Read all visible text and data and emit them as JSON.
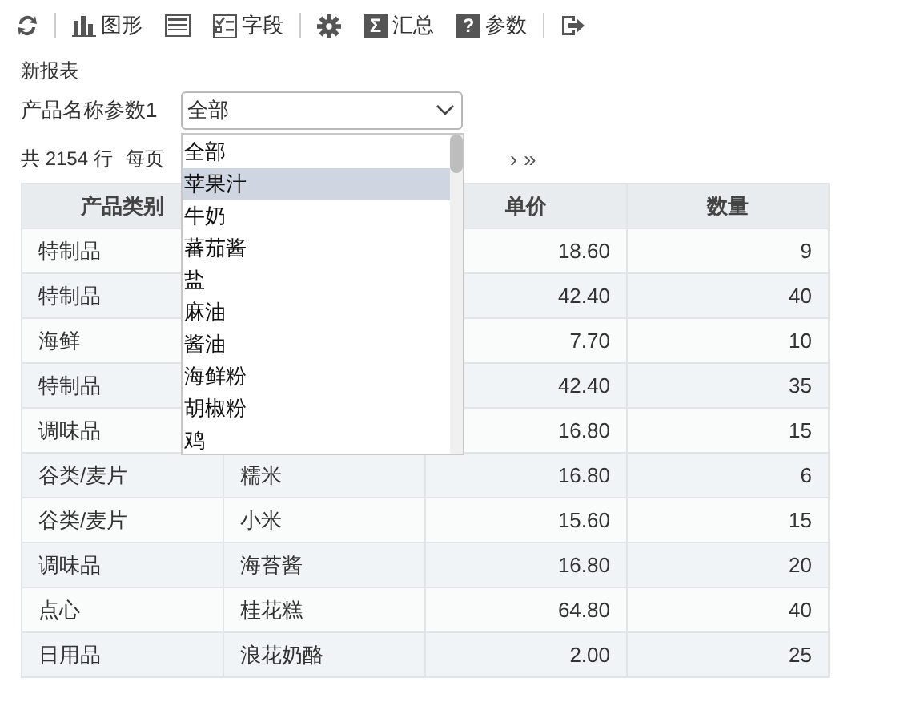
{
  "toolbar": [
    {
      "kind": "refresh"
    },
    {
      "kind": "separator"
    },
    {
      "kind": "chart",
      "label": "图形"
    },
    {
      "kind": "layout"
    },
    {
      "kind": "fields",
      "label": "字段"
    },
    {
      "kind": "separator"
    },
    {
      "kind": "settings"
    },
    {
      "kind": "glyph",
      "glyph": "Σ",
      "label": "汇总"
    },
    {
      "kind": "glyph",
      "glyph": "?",
      "label": "参数"
    },
    {
      "kind": "separator"
    },
    {
      "kind": "exit"
    }
  ],
  "report_title": "新报表",
  "parameter": {
    "label": "产品名称参数1",
    "value": "全部",
    "expanded": true,
    "options": [
      {
        "label": "全部",
        "highlighted": false
      },
      {
        "label": "苹果汁",
        "highlighted": true
      },
      {
        "label": "牛奶",
        "highlighted": false
      },
      {
        "label": "蕃茄酱",
        "highlighted": false
      },
      {
        "label": "盐",
        "highlighted": false
      },
      {
        "label": "麻油",
        "highlighted": false
      },
      {
        "label": "酱油",
        "highlighted": false
      },
      {
        "label": "海鲜粉",
        "highlighted": false
      },
      {
        "label": "胡椒粉",
        "highlighted": false
      },
      {
        "label": "鸡",
        "highlighted": false
      }
    ]
  },
  "pagination": {
    "total": "共 2154 行",
    "per_page": "每页",
    "next": "›",
    "last": "»"
  },
  "table": {
    "columns": [
      "产品类别",
      null,
      "单价",
      "数量"
    ],
    "rows": [
      {
        "category": "特制品",
        "price": "18.60",
        "quantity": "9"
      },
      {
        "category": "特制品",
        "price": "42.40",
        "quantity": "40"
      },
      {
        "category": "海鲜",
        "price": "7.70",
        "quantity": "10"
      },
      {
        "category": "特制品",
        "price": "42.40",
        "quantity": "35"
      },
      {
        "category": "调味品",
        "price": "16.80",
        "quantity": "15"
      },
      {
        "category": "谷类/麦片",
        "product": "糯米",
        "price": "16.80",
        "quantity": "6"
      },
      {
        "category": "谷类/麦片",
        "product": "小米",
        "price": "15.60",
        "quantity": "15"
      },
      {
        "category": "调味品",
        "product": "海苔酱",
        "price": "16.80",
        "quantity": "20"
      },
      {
        "category": "点心",
        "product": "桂花糕",
        "price": "64.80",
        "quantity": "40"
      },
      {
        "category": "日用品",
        "product": "浪花奶酪",
        "price": "2.00",
        "quantity": "25"
      }
    ]
  }
}
